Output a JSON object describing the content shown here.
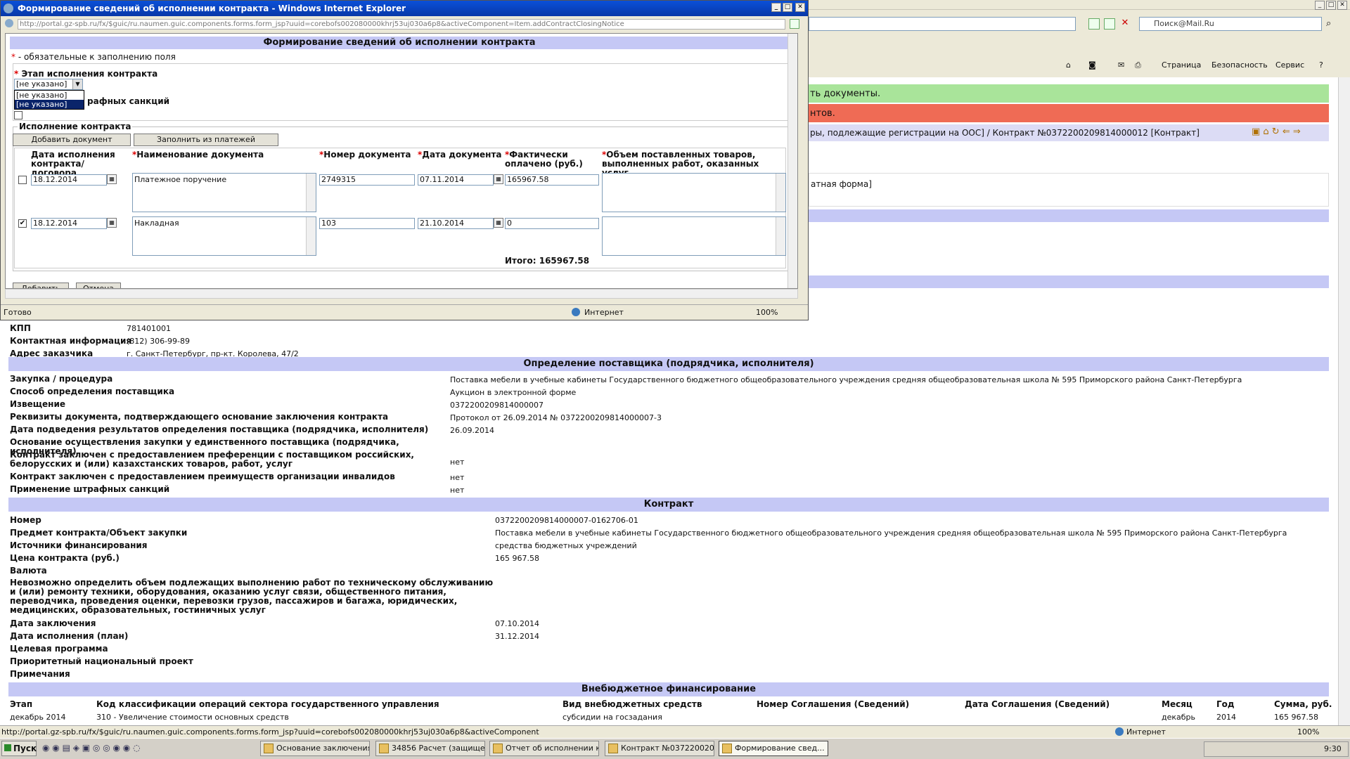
{
  "popup": {
    "title": "Формирование сведений об исполнении контракта - Windows Internet Explorer",
    "url": "http://portal.gz-spb.ru/fx/$guic/ru.naumen.guic.components.forms.form_jsp?uuid=corebofs002080000khrj53uj030a6p8&activeComponent=Item.addContractClosingNotice",
    "header": "Формирование сведений об исполнении контракта",
    "required_note": "- обязательные к заполнению поля",
    "stage_label": "Этап исполнения контракта",
    "stage_value": "[не указано]",
    "stage_options": [
      "[не указано]",
      "[не указано]"
    ],
    "penalty_label_partial": "рафных санкций",
    "fieldset_label": "Исполнение контракта",
    "add_doc_btn": "Добавить документ",
    "fill_btn": "Заполнить из платежей",
    "columns": {
      "date": "Дата исполнения контракта/договора",
      "docname": "Наименование документа",
      "docnum": "Номер документа",
      "docdate": "Дата документа",
      "paid": "Фактически оплачено (руб.)",
      "volume": "Объем поставленных товаров, выполненных работ, оказанных услуг"
    },
    "rows": [
      {
        "date": "18.12.2014",
        "docname": "Платежное поручение",
        "docnum": "2749315",
        "docdate": "07.11.2014",
        "paid": "165967.58",
        "checked": false
      },
      {
        "date": "18.12.2014",
        "docname": "Накладная",
        "docnum": "103",
        "docdate": "21.10.2014",
        "paid": "0",
        "checked": true
      }
    ],
    "total": "Итого: 165967.58",
    "add_btn": "Добавить",
    "cancel_btn": "Отмена",
    "status_left": "Готово",
    "status_zone": "Интернет",
    "status_zoom": "100%"
  },
  "browser": {
    "search_placeholder": "Поиск@Mail.Ru",
    "cmd_page": "Страница",
    "cmd_security": "Безопасность",
    "cmd_service": "Сервис",
    "green_msg": "ть документы.",
    "red_msg": "нтов.",
    "breadcrumb": "ры, подлежащие регистрации на ООС] / Контракт №0372200209814000012 [Контракт]",
    "partial_text": "атная форма]"
  },
  "customer": [
    {
      "label": "КПП",
      "value": "781401001"
    },
    {
      "label": "Контактная информация",
      "value": "(812) 306-99-89"
    },
    {
      "label": "Адрес заказчика",
      "value": "г. Санкт-Петербург, пр-кт. Королева, 47/2"
    }
  ],
  "supplier_section": "Определение поставщика (подрядчика, исполнителя)",
  "supplier": [
    {
      "label": "Закупка / процедура",
      "value": "Поставка мебели в учебные кабинеты Государственного бюджетного общеобразовательного учреждения средняя общеобразовательная школа № 595 Приморского района Санкт-Петербурга"
    },
    {
      "label": "Способ определения поставщика",
      "value": "Аукцион в электронной форме"
    },
    {
      "label": "Извещение",
      "value": "0372200209814000007"
    },
    {
      "label": "Реквизиты документа, подтверждающего основание заключения контракта",
      "value": "Протокол от 26.09.2014 № 0372200209814000007-3"
    },
    {
      "label": "Дата подведения результатов определения поставщика (подрядчика, исполнителя)",
      "value": "26.09.2014"
    },
    {
      "label": "Основание осуществления закупки у единственного поставщика (подрядчика, исполнителя)",
      "value": ""
    },
    {
      "label": "Контракт заключен с предоставлением преференции с поставщиком российских, белорусских и (или) казахстанских товаров, работ, услуг",
      "value": "нет"
    },
    {
      "label": "Контракт заключен с предоставлением преимуществ организации инвалидов",
      "value": "нет"
    },
    {
      "label": "Применение штрафных санкций",
      "value": "нет"
    }
  ],
  "contract_section": "Контракт",
  "contract": [
    {
      "label": "Номер",
      "value": "0372200209814000007-0162706-01"
    },
    {
      "label": "Предмет контракта/Объект закупки",
      "value": "Поставка мебели в учебные кабинеты Государственного бюджетного общеобразовательного учреждения средняя общеобразовательная школа № 595 Приморского района Санкт-Петербурга"
    },
    {
      "label": "Источники финансирования",
      "value": "средства бюджетных учреждений"
    },
    {
      "label": "Цена контракта (руб.)",
      "value": "165 967.58"
    },
    {
      "label": "Валюта",
      "value": ""
    },
    {
      "label": "Невозможно определить объем подлежащих выполнению работ по техническому обслуживанию и (или) ремонту техники, оборудования, оказанию услуг связи, общественного питания, переводчика, проведения оценки, перевозки грузов, пассажиров и багажа, юридических, медицинских, образовательных, гостиничных услуг",
      "value": ""
    },
    {
      "label": "Дата заключения",
      "value": "07.10.2014"
    },
    {
      "label": "Дата исполнения (план)",
      "value": "31.12.2014"
    },
    {
      "label": "Целевая программа",
      "value": ""
    },
    {
      "label": "Приоритетный национальный проект",
      "value": ""
    },
    {
      "label": "Примечания",
      "value": ""
    }
  ],
  "extra_section": "Внебюджетное финансирование",
  "extra_headers": [
    "Этап",
    "Код классификации операций сектора государственного управления",
    "Вид внебюджетных средств",
    "Номер Соглашения (Сведений)",
    "Дата Соглашения (Сведений)",
    "Месяц",
    "Год",
    "Сумма, руб."
  ],
  "extra_row": [
    "декабрь 2014",
    "310 - Увеличение стоимости основных средств",
    "субсидии на госзадания",
    "",
    "",
    "декабрь",
    "2014",
    "165 967.58"
  ],
  "status_main": {
    "url": "http://portal.gz-spb.ru/fx/$guic/ru.naumen.guic.components.forms.form_jsp?uuid=corebofs002080000khrj53uj030a6p8&activeComponent",
    "zone": "Интернет",
    "zoom": "100%"
  },
  "taskbar": {
    "start": "Пуск",
    "tasks": [
      "Основание заключения...",
      "34856 Расчет (защище...",
      "Отчет об исполнении к...",
      "Контракт №037220020...",
      "Формирование свед..."
    ],
    "clock": "9:30"
  }
}
